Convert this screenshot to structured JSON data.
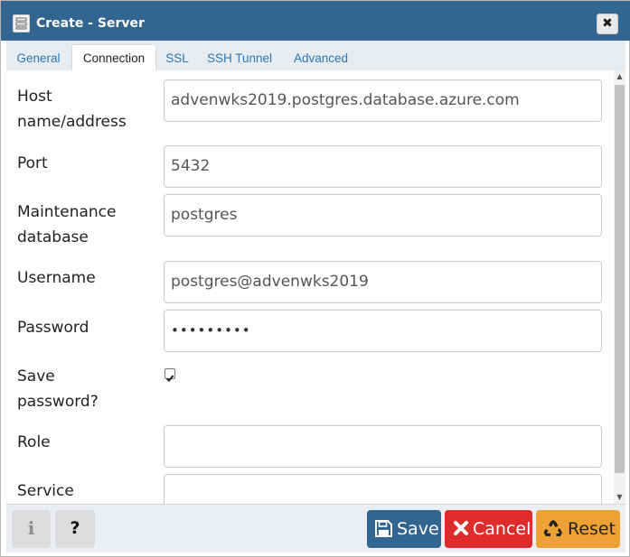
{
  "window": {
    "title": "Create - Server",
    "close_glyph": "✖",
    "icons": {
      "app": "server-icon",
      "close": "close-icon"
    }
  },
  "tabs": [
    {
      "label": "General",
      "active": false
    },
    {
      "label": "Connection",
      "active": true
    },
    {
      "label": "SSL",
      "active": false
    },
    {
      "label": "SSH Tunnel",
      "active": false
    },
    {
      "label": "Advanced",
      "active": false
    }
  ],
  "form": {
    "host": {
      "label_line1": "Host",
      "label_line2": "name/address",
      "value": "advenwks2019.postgres.database.azure.com"
    },
    "port": {
      "label": "Port",
      "value": "5432"
    },
    "maintenance_db": {
      "label_line1": "Maintenance",
      "label_line2": "database",
      "value": "postgres"
    },
    "username": {
      "label": "Username",
      "value": "postgres@advenwks2019"
    },
    "password": {
      "label": "Password",
      "value": "•••••••••"
    },
    "save_password": {
      "label_line1": "Save",
      "label_line2": "password?",
      "checked": true
    },
    "role": {
      "label": "Role",
      "value": ""
    },
    "service": {
      "label": "Service",
      "value": ""
    }
  },
  "footer": {
    "info_glyph": "i",
    "help_glyph": "?",
    "save_label": "Save",
    "cancel_label": "Cancel",
    "reset_label": "Reset",
    "icons": {
      "info": "info-icon",
      "help": "help-icon",
      "save": "floppy-disk-icon",
      "cancel": "x-icon",
      "reset": "recycle-icon"
    }
  },
  "colors": {
    "titlebar": "#326690",
    "tab_link": "#2c77b4",
    "save_button": "#326690",
    "cancel_button": "#de2b2b",
    "reset_button": "#eea236"
  }
}
